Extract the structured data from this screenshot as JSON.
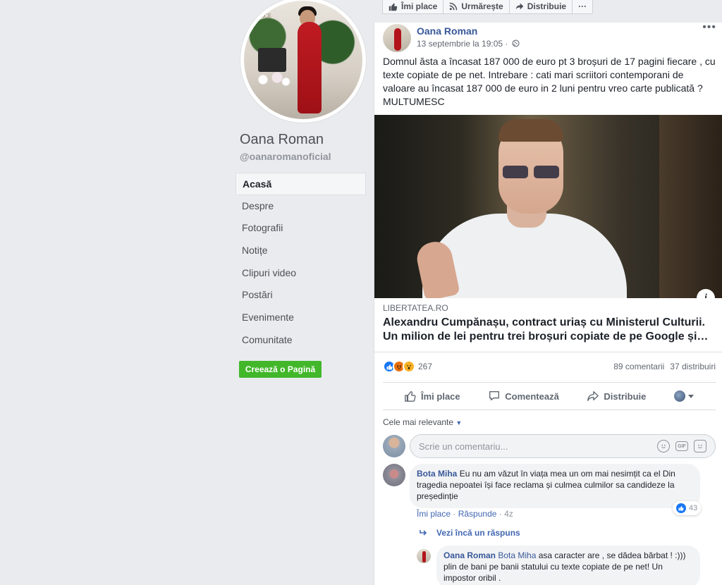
{
  "sidebar": {
    "page_name": "Oana Roman",
    "handle": "@oanaromanoficial",
    "profile_sign_text": "PLACE",
    "nav": [
      {
        "label": "Acasă",
        "active": true
      },
      {
        "label": "Despre"
      },
      {
        "label": "Fotografii"
      },
      {
        "label": "Notițe"
      },
      {
        "label": "Clipuri video"
      },
      {
        "label": "Postări"
      },
      {
        "label": "Evenimente"
      },
      {
        "label": "Comunitate"
      }
    ],
    "create_page_label": "Creează o Pagină"
  },
  "topbar": {
    "like_label": "Îmi place",
    "follow_label": "Urmărește",
    "share_label": "Distribuie",
    "more_label": "···"
  },
  "post": {
    "author": "Oana Roman",
    "date": "13 septembrie la 19:05 ·",
    "more_label": "•••",
    "text": "Domnul ăsta a încasat 187 000 de euro pt 3 broșuri de 17 pagini fiecare , cu texte copiate de pe net. Intrebare : cati mari scriitori contemporani de valoare au încasat 187 000 de euro in 2 luni pentru vreo carte publicată ? MULTUMESC",
    "link": {
      "domain": "LIBERTATEA.RO",
      "title": "Alexandru Cumpănașu, contract uriaș cu Ministerul Culturii. Un milion de lei pentru trei broșuri copiate de pe Google și…",
      "info_label": "i"
    },
    "reactions_count": "267",
    "comments_count": "89 comentarii",
    "shares_count": "37 distribuiri",
    "actions": {
      "like": "Îmi place",
      "comment": "Comentează",
      "share": "Distribuie"
    },
    "sort_label": "Cele mai relevante",
    "composer_placeholder": "Scrie un comentariu...",
    "composer_gif": "GIF"
  },
  "comments": [
    {
      "author": "Bota Miha",
      "text": "Eu nu am văzut în viața mea un om mai nesimțit ca el Din tragedia nepoatei își face reclama și culmea culmilor sa candideze la președinție",
      "reactions": "43",
      "like_action": "Îmi place",
      "reply_action": "Răspunde",
      "age": "4z"
    }
  ],
  "more_replies_label": "Vezi încă un răspuns",
  "reply": {
    "author": "Oana Roman",
    "mention": "Bota Miha",
    "text": "asa caracter are , se dădea bărbat ! :))) plin de bani pe banii statului cu texte copiate de pe net! Un impostor oribil ."
  },
  "colors": {
    "brand_blue": "#4267b2",
    "link_blue": "#385898",
    "create_green": "#42b72a",
    "background": "#e9ebee"
  }
}
